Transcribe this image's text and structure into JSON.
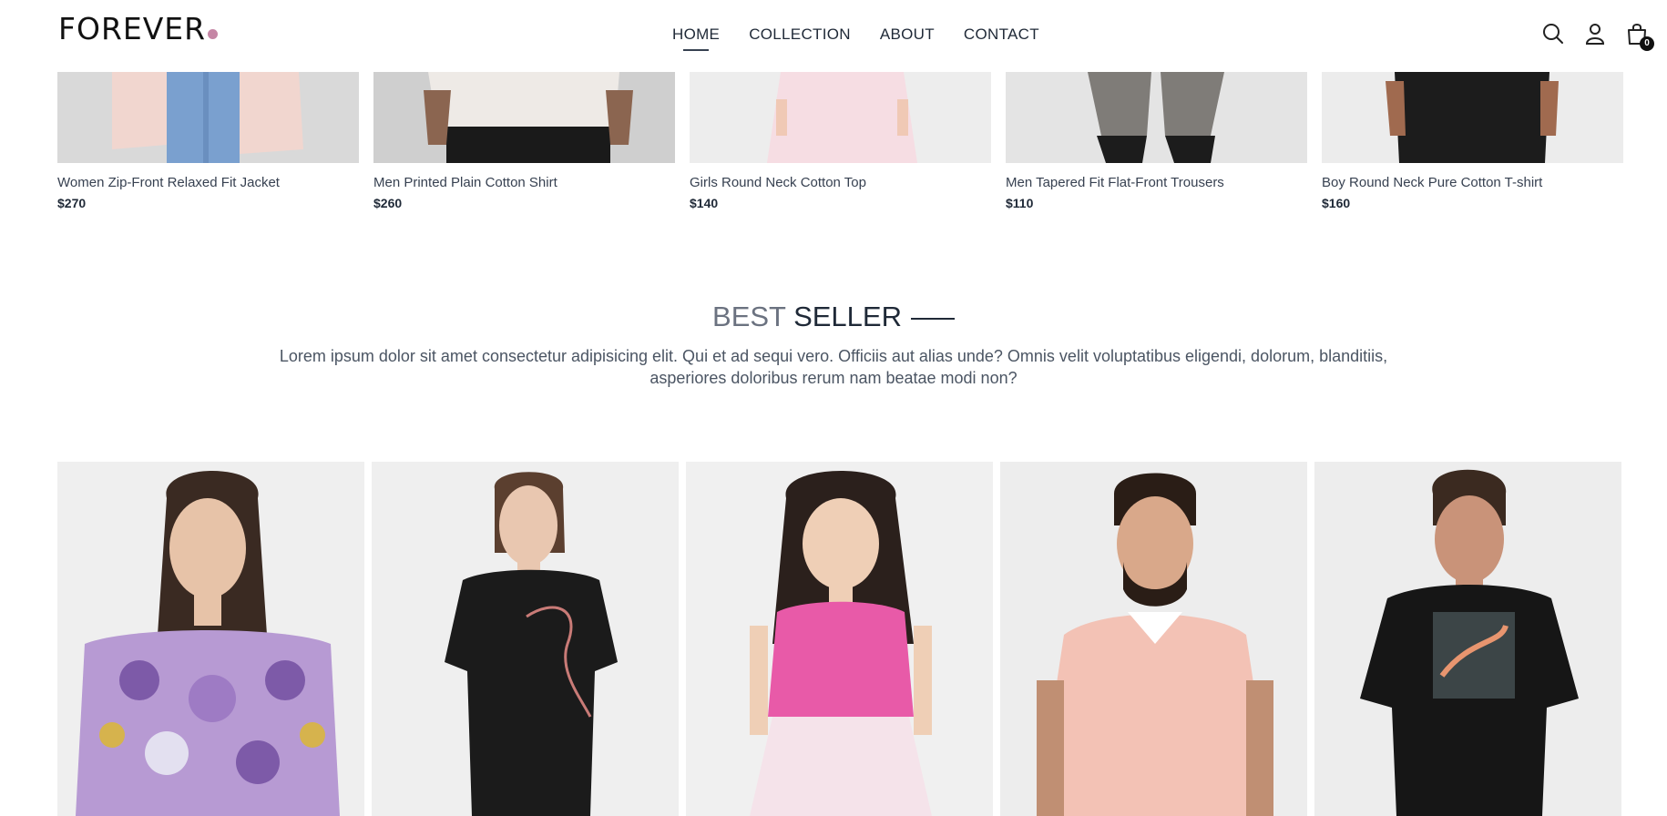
{
  "header": {
    "logo": "FOREVER",
    "nav": [
      "HOME",
      "COLLECTION",
      "ABOUT",
      "CONTACT"
    ],
    "cart_count": "0",
    "icons": [
      "search-icon",
      "profile-icon",
      "cart-icon"
    ]
  },
  "top_products": [
    {
      "name": "Women Zip-Front Relaxed Fit Jacket",
      "price": "$270"
    },
    {
      "name": "Men Printed Plain Cotton Shirt",
      "price": "$260"
    },
    {
      "name": "Girls Round Neck Cotton Top",
      "price": "$140"
    },
    {
      "name": "Men Tapered Fit Flat-Front Trousers",
      "price": "$110"
    },
    {
      "name": "Boy Round Neck Pure Cotton T-shirt",
      "price": "$160"
    }
  ],
  "best_seller": {
    "title_light": "BEST",
    "title_bold": "SELLER",
    "description": "Lorem ipsum dolor sit amet consectetur adipisicing elit. Qui et ad sequi vero. Officiis aut alias unde? Omnis velit voluptatibus eligendi, dolorum, blanditiis, asperiores doloribus rerum nam beatae modi non?"
  },
  "colors": {
    "accent_dot": "#c586a5",
    "text_dark": "#1f2937",
    "text_muted": "#6b7280"
  }
}
